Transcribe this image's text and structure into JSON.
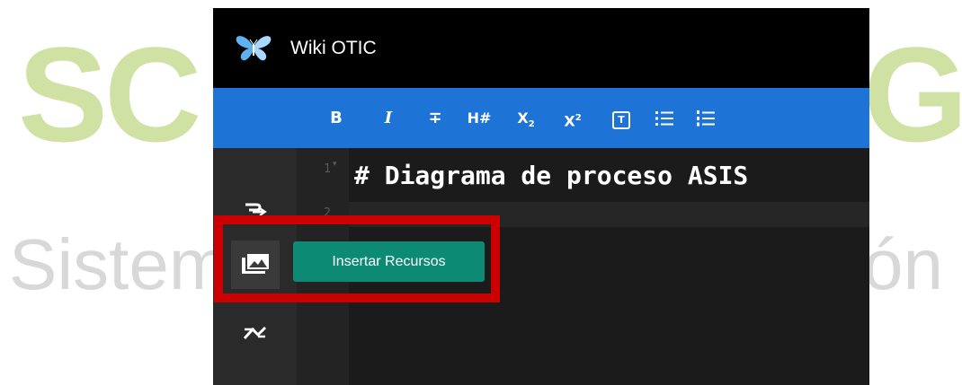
{
  "background": {
    "watermark_left": "SC",
    "watermark_right": "G",
    "subtitle_left": "Sistem",
    "subtitle_right": "ón"
  },
  "app": {
    "title": "Wiki OTIC",
    "logo_icon": "butterfly-logo-icon"
  },
  "toolbar": {
    "bold": "B",
    "italic": "I",
    "strikethrough": "∓",
    "heading": "H#",
    "subscript_base": "X",
    "subscript_mark": "2",
    "superscript_base": "X",
    "superscript_mark": "2",
    "blockquote": "T",
    "bullet_list_icon": "bullet-list-icon",
    "numbered_list_icon": "numbered-list-icon"
  },
  "editor": {
    "line_numbers": [
      "1",
      "2"
    ],
    "lines": [
      "# Diagrama de proceso ASIS"
    ]
  },
  "sidebar": {
    "icons": [
      "link-icon",
      "image-folder-icon",
      "merge-icon"
    ]
  },
  "tooltip": {
    "label": "Insertar Recursos"
  },
  "colors": {
    "titlebar": "#000000",
    "toolbar": "#1e73d6",
    "tooltip": "#0d8a74",
    "highlight": "#cc0000",
    "watermark": "#cfe2a4"
  }
}
